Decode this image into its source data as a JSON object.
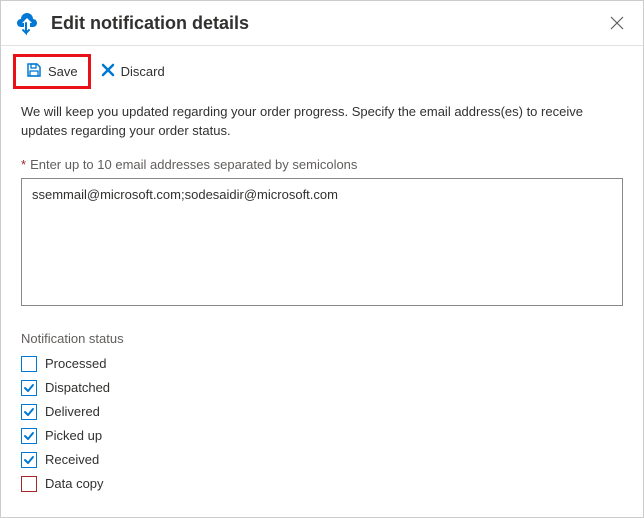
{
  "header": {
    "title": "Edit notification details"
  },
  "toolbar": {
    "save_label": "Save",
    "discard_label": "Discard"
  },
  "description": "We will keep you updated regarding your order progress. Specify the email address(es) to receive updates regarding your order status.",
  "email_field": {
    "label": "Enter up to 10 email addresses separated by semicolons",
    "value": "ssemmail@microsoft.com;sodesaidir@microsoft.com"
  },
  "status_section": {
    "label": "Notification status",
    "items": [
      {
        "label": "Processed",
        "checked": false,
        "variant": "blue"
      },
      {
        "label": "Dispatched",
        "checked": true,
        "variant": "blue"
      },
      {
        "label": "Delivered",
        "checked": true,
        "variant": "blue"
      },
      {
        "label": "Picked up",
        "checked": true,
        "variant": "blue"
      },
      {
        "label": "Received",
        "checked": true,
        "variant": "blue"
      },
      {
        "label": "Data copy",
        "checked": false,
        "variant": "magenta"
      }
    ]
  }
}
